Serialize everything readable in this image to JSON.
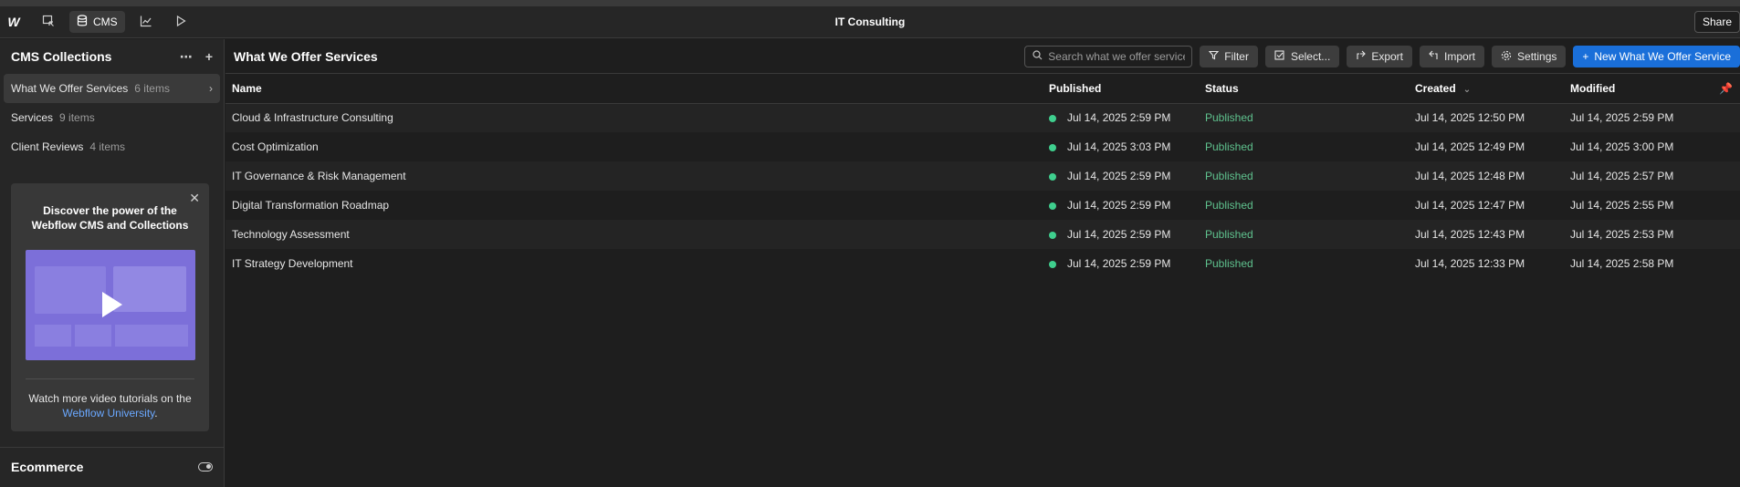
{
  "topbar": {
    "logo": "W",
    "cms_label": "CMS",
    "site_title": "IT Consulting",
    "share_label": "Share"
  },
  "sidebar": {
    "title": "CMS Collections",
    "items": [
      {
        "label": "What We Offer Services",
        "count": "6 items"
      },
      {
        "label": "Services",
        "count": "9 items"
      },
      {
        "label": "Client Reviews",
        "count": "4 items"
      }
    ],
    "promo": {
      "title": "Discover the power of the Webflow CMS and Collections",
      "text_before": "Watch more video tutorials on the",
      "link": "Webflow University",
      "text_after": "."
    },
    "ecommerce_label": "Ecommerce"
  },
  "main": {
    "title": "What We Offer Services",
    "search_placeholder": "Search what we offer services",
    "filter_label": "Filter",
    "select_label": "Select...",
    "export_label": "Export",
    "import_label": "Import",
    "settings_label": "Settings",
    "new_label": "New What We Offer Service",
    "columns": {
      "name": "Name",
      "published": "Published",
      "status": "Status",
      "created": "Created",
      "modified": "Modified"
    },
    "rows": [
      {
        "name": "Cloud & Infrastructure Consulting",
        "published": "Jul 14, 2025 2:59 PM",
        "status": "Published",
        "created": "Jul 14, 2025 12:50 PM",
        "modified": "Jul 14, 2025 2:59 PM"
      },
      {
        "name": "Cost Optimization",
        "published": "Jul 14, 2025 3:03 PM",
        "status": "Published",
        "created": "Jul 14, 2025 12:49 PM",
        "modified": "Jul 14, 2025 3:00 PM"
      },
      {
        "name": "IT Governance & Risk Management",
        "published": "Jul 14, 2025 2:59 PM",
        "status": "Published",
        "created": "Jul 14, 2025 12:48 PM",
        "modified": "Jul 14, 2025 2:57 PM"
      },
      {
        "name": "Digital Transformation Roadmap",
        "published": "Jul 14, 2025 2:59 PM",
        "status": "Published",
        "created": "Jul 14, 2025 12:47 PM",
        "modified": "Jul 14, 2025 2:55 PM"
      },
      {
        "name": "Technology Assessment",
        "published": "Jul 14, 2025 2:59 PM",
        "status": "Published",
        "created": "Jul 14, 2025 12:43 PM",
        "modified": "Jul 14, 2025 2:53 PM"
      },
      {
        "name": "IT Strategy Development",
        "published": "Jul 14, 2025 2:59 PM",
        "status": "Published",
        "created": "Jul 14, 2025 12:33 PM",
        "modified": "Jul 14, 2025 2:58 PM"
      }
    ]
  },
  "colors": {
    "accent": "#1a6fd9",
    "status_green": "#5fc28e",
    "link": "#6aa8ff"
  }
}
